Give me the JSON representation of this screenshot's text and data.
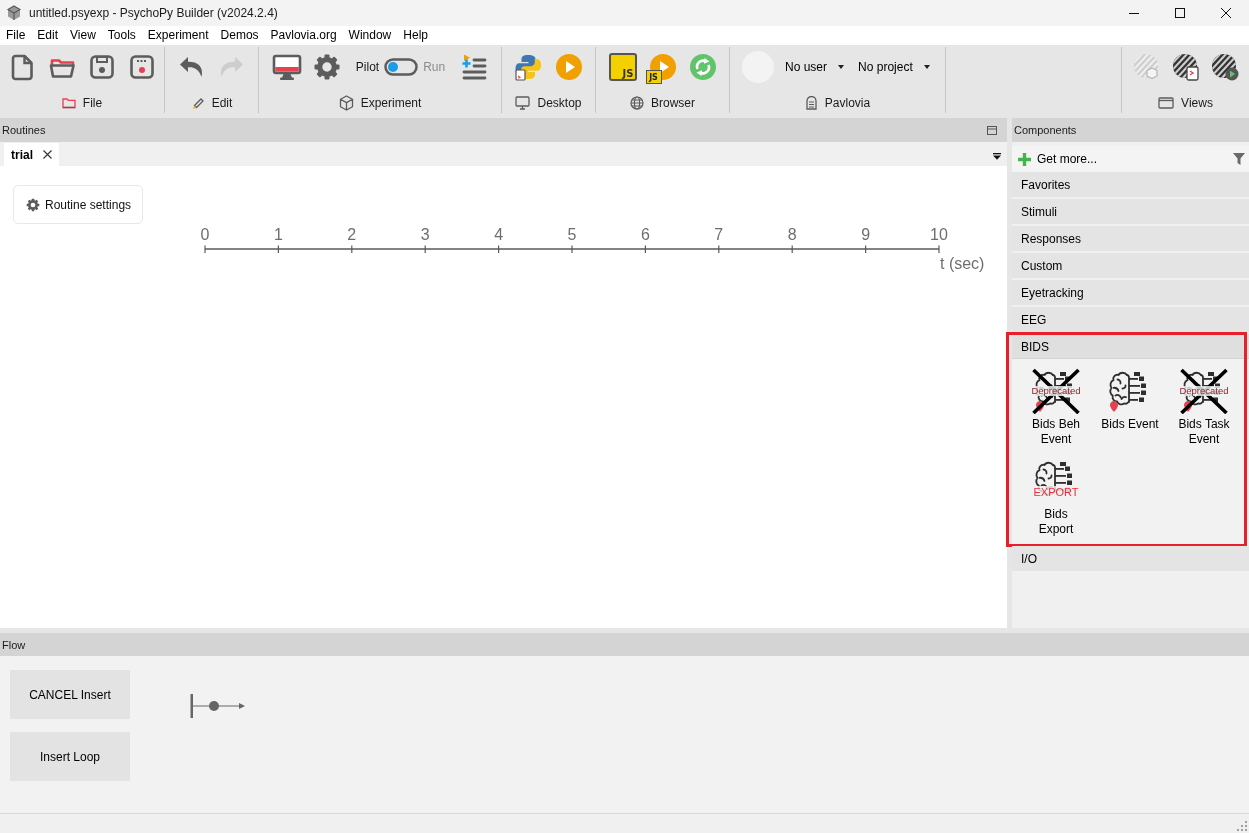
{
  "window": {
    "title": "untitled.psyexp - PsychoPy Builder (v2024.2.4)"
  },
  "menu_bar": [
    {
      "label": "File"
    },
    {
      "label": "Edit"
    },
    {
      "label": "View"
    },
    {
      "label": "Tools"
    },
    {
      "label": "Experiment"
    },
    {
      "label": "Demos"
    },
    {
      "label": "Pavlovia.org"
    },
    {
      "label": "Window"
    },
    {
      "label": "Help"
    }
  ],
  "toolbar": {
    "file": {
      "label": "File"
    },
    "edit": {
      "label": "Edit",
      "undo": {
        "disabled": false
      },
      "redo": {
        "disabled": true
      }
    },
    "experiment": {
      "label": "Experiment",
      "mode_switch": {
        "left_label": "Pilot",
        "right_label": "Run",
        "on": false
      }
    },
    "desktop": {
      "label": "Desktop"
    },
    "browser": {
      "label": "Browser",
      "compile_js_badge": "JS",
      "run_js_badge": "JS"
    },
    "pavlovia": {
      "label": "Pavlovia",
      "user": "No user",
      "project": "No project"
    },
    "views": {
      "label": "Views",
      "builder": {
        "disabled": true
      },
      "coder": {
        "disabled": false
      },
      "runner": {
        "disabled": false
      }
    }
  },
  "routines_panel": {
    "title": "Routines",
    "tabs": [
      {
        "label": "trial",
        "selected": true
      }
    ],
    "routine_settings_button": "Routine settings",
    "timeline": {
      "ticks": [
        "0",
        "1",
        "2",
        "3",
        "4",
        "5",
        "6",
        "7",
        "8",
        "9",
        "10"
      ],
      "unit_label": "t (sec)"
    }
  },
  "components_panel": {
    "title": "Components",
    "get_more": "Get more...",
    "categories": [
      {
        "label": "Favorites",
        "expanded": false,
        "highlighted": false
      },
      {
        "label": "Stimuli",
        "expanded": false,
        "highlighted": false
      },
      {
        "label": "Responses",
        "expanded": false,
        "highlighted": false
      },
      {
        "label": "Custom",
        "expanded": false,
        "highlighted": false
      },
      {
        "label": "Eyetracking",
        "expanded": false,
        "highlighted": false
      },
      {
        "label": "EEG",
        "expanded": false,
        "highlighted": false
      },
      {
        "label": "BIDS",
        "expanded": true,
        "highlighted": true,
        "components": [
          {
            "label": "Bids Beh Event",
            "overlay": "Deprecated",
            "deprecated": true
          },
          {
            "label": "Bids Event",
            "deprecated": false
          },
          {
            "label": "Bids Task Event",
            "overlay": "Deprecated",
            "deprecated": true
          },
          {
            "label": "Bids Export",
            "overlay": "EXPORT",
            "deprecated": false
          }
        ]
      },
      {
        "label": "I/O",
        "expanded": false,
        "highlighted": false
      }
    ]
  },
  "flow_panel": {
    "title": "Flow",
    "buttons": [
      {
        "label": "CANCEL Insert"
      },
      {
        "label": "Insert Loop"
      }
    ]
  }
}
